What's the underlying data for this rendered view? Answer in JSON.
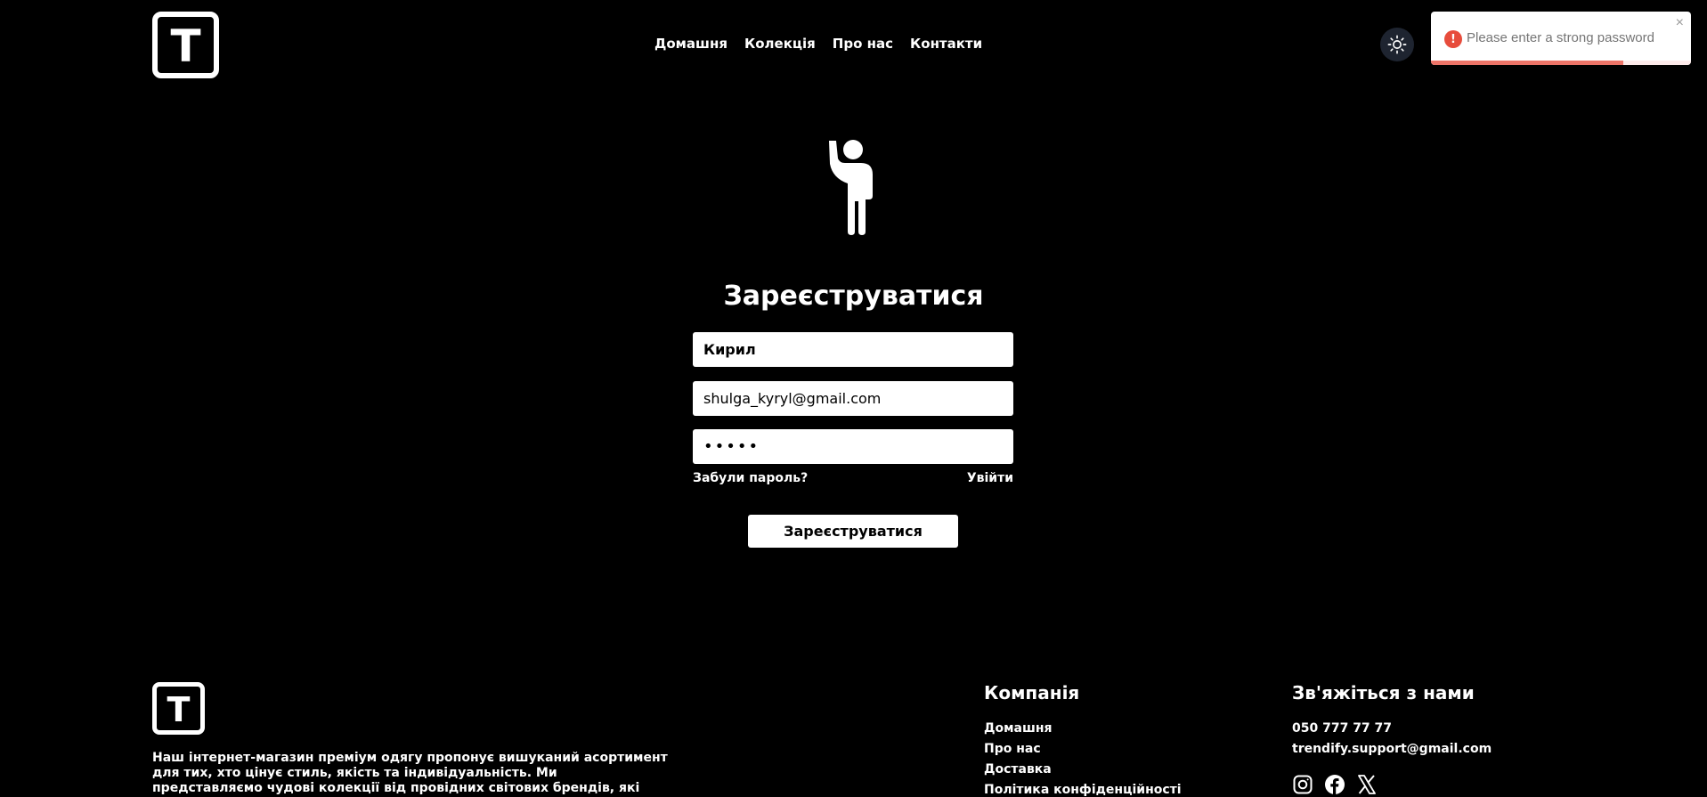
{
  "header": {
    "logo_letter": "T",
    "nav": [
      "Домашня",
      "Колекція",
      "Про нас",
      "Контакти"
    ]
  },
  "toast": {
    "message": "Please enter a strong password",
    "close_label": "×",
    "icon_glyph": "!",
    "progress": 0.74,
    "accent_color": "#e74c3c"
  },
  "form": {
    "title": "Зареєструватися",
    "name_value": "Кирил",
    "email_value": "shulga_kyryl@gmail.com",
    "password_value": "•••••",
    "forgot_label": "Забули пароль?",
    "login_label": "Увійти",
    "submit_label": "Зареєструватися"
  },
  "footer": {
    "logo_letter": "T",
    "about": "Наш інтернет-магазин преміум одягу пропонує вишуканий асортимент для тих, хто цінує стиль, якість та індивідуальність. Ми представляємо чудові колекції від провідних світових брендів, які поєднують модні тренди та",
    "company": {
      "title": "Компанія",
      "links": [
        "Домашня",
        "Про нас",
        "Доставка",
        "Політика конфіденційності"
      ]
    },
    "contact": {
      "title": "Зв'яжіться з нами",
      "phone": "050 777 77 77",
      "email": "trendify.support@gmail.com",
      "socials": [
        "instagram-icon",
        "facebook-icon",
        "x-icon"
      ]
    }
  }
}
